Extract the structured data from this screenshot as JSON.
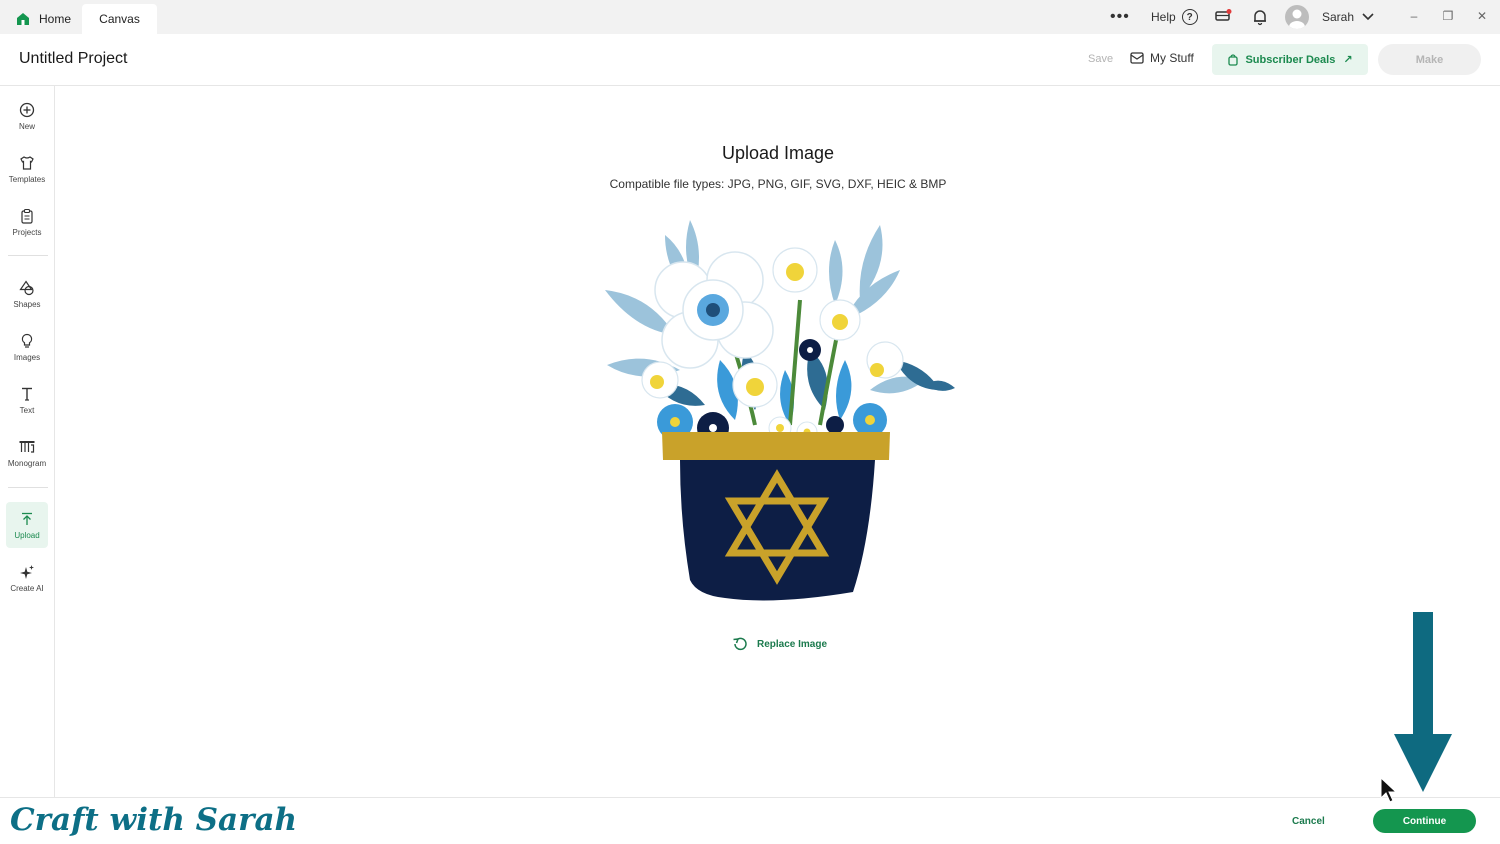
{
  "titlebar": {
    "tabs": [
      {
        "label": "Home",
        "icon": "home-icon"
      },
      {
        "label": "Canvas"
      }
    ],
    "more_label": "•••",
    "help_label": "Help",
    "help_icon_glyph": "?",
    "user_name": "Sarah",
    "window_controls": {
      "minimize": "–",
      "restore": "❐",
      "close": "✕"
    }
  },
  "header": {
    "project_title": "Untitled Project",
    "save_label": "Save",
    "mystuff_label": "My Stuff",
    "deals_label": "Subscriber Deals",
    "deals_arrow": "↗",
    "make_label": "Make",
    "accent_color": "#1b8a4f"
  },
  "sidebar": {
    "items": [
      {
        "label": "New",
        "icon": "plus-circle-icon"
      },
      {
        "label": "Templates",
        "icon": "tshirt-icon"
      },
      {
        "label": "Projects",
        "icon": "clipboard-icon"
      },
      {
        "label": "Shapes",
        "icon": "shapes-icon"
      },
      {
        "label": "Images",
        "icon": "lightbulb-icon"
      },
      {
        "label": "Text",
        "icon": "text-t-icon"
      },
      {
        "label": "Monogram",
        "icon": "monogram-icon"
      },
      {
        "label": "Upload",
        "icon": "upload-icon",
        "active": true
      },
      {
        "label": "Create AI",
        "icon": "sparkle-icon"
      }
    ]
  },
  "main": {
    "title": "Upload Image",
    "subtitle": "Compatible file types:  JPG, PNG, GIF, SVG, DXF, HEIC & BMP",
    "replace_label": "Replace Image"
  },
  "footer": {
    "brand": "Craft with Sarah",
    "cancel_label": "Cancel",
    "continue_label": "Continue",
    "continue_color": "#14964f"
  },
  "overlay": {
    "arrow_color": "#0e6a80"
  }
}
